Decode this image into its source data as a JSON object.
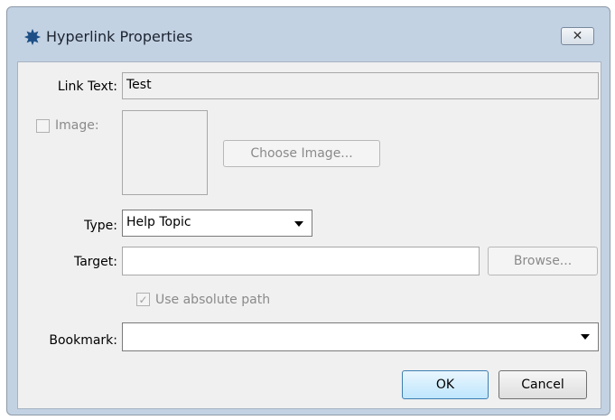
{
  "window": {
    "title": "Hyperlink Properties",
    "close_glyph": "✕",
    "app_icon": "maple-leaf-icon"
  },
  "form": {
    "link_text": {
      "label": "Link Text:",
      "value": "Test"
    },
    "image": {
      "label": "Image:",
      "checked": false,
      "choose_label": "Choose Image..."
    },
    "type": {
      "label": "Type:",
      "value": "Help Topic"
    },
    "target": {
      "label": "Target:",
      "value": "",
      "browse_label": "Browse..."
    },
    "absolute_path": {
      "label": "Use absolute path",
      "checked": true,
      "check_glyph": "✓"
    },
    "bookmark": {
      "label": "Bookmark:",
      "value": ""
    }
  },
  "buttons": {
    "ok": "OK",
    "cancel": "Cancel"
  },
  "colors": {
    "frame": "#c3d2e3",
    "client": "#f0f0f0",
    "default_button": "#bee6fd"
  }
}
